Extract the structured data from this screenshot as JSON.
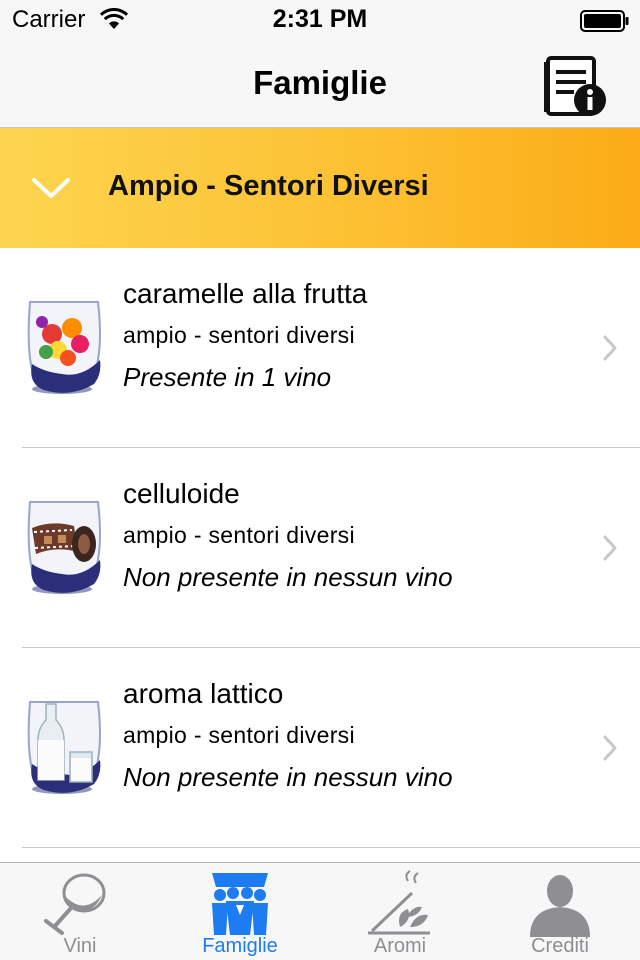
{
  "status_bar": {
    "carrier": "Carrier",
    "time": "2:31 PM"
  },
  "nav": {
    "title": "Famiglie",
    "right_icon": "book-info-icon"
  },
  "section": {
    "title": "Ampio - Sentori Diversi",
    "icon": "chevron-down-icon",
    "gradient_colors": [
      "#fdd54f",
      "#fbab16"
    ]
  },
  "items": [
    {
      "title": "caramelle alla frutta",
      "subtitle": "ampio - sentori diversi",
      "status": "Presente in 1 vino",
      "image": "fruit-candies-in-glass"
    },
    {
      "title": "celluloide",
      "subtitle": "ampio - sentori diversi",
      "status": "Non presente in nessun vino",
      "image": "film-roll-in-glass"
    },
    {
      "title": "aroma lattico",
      "subtitle": "ampio - sentori diversi",
      "status": "Non presente in nessun vino",
      "image": "milk-bottle-in-glass"
    }
  ],
  "tabs": [
    {
      "label": "Vini",
      "icon": "wine-glass-icon",
      "active": false
    },
    {
      "label": "Famiglie",
      "icon": "family-group-icon",
      "active": true
    },
    {
      "label": "Aromi",
      "icon": "aroma-leaves-icon",
      "active": false
    },
    {
      "label": "Crediti",
      "icon": "person-icon",
      "active": false
    }
  ],
  "colors": {
    "accent": "#1d7cf2",
    "inactive_tab": "#8e8e93"
  }
}
